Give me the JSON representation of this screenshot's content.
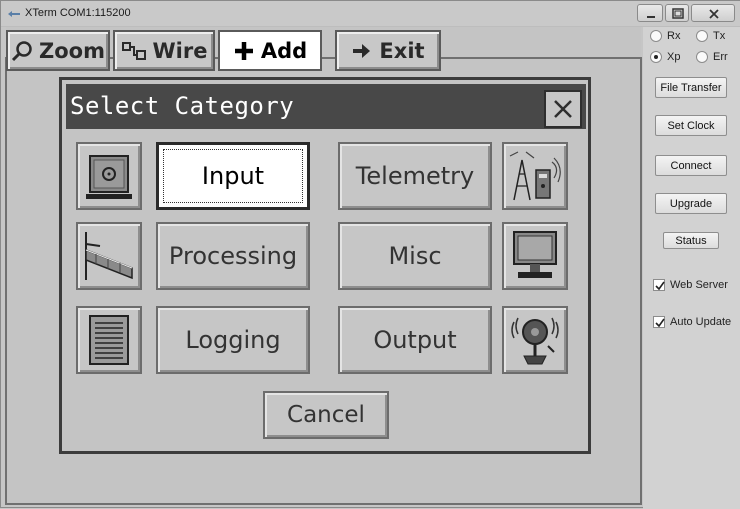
{
  "window": {
    "title": "XTerm COM1:115200"
  },
  "toolbar": {
    "zoom": "Zoom",
    "wire": "Wire",
    "add": "Add",
    "exit": "Exit"
  },
  "dialog": {
    "title": "Select Category",
    "categories": {
      "input": "Input",
      "telemetry": "Telemetry",
      "processing": "Processing",
      "misc": "Misc",
      "logging": "Logging",
      "output": "Output"
    },
    "cancel": "Cancel"
  },
  "side": {
    "radios": {
      "rx": "Rx",
      "tx": "Tx",
      "xp": "Xp",
      "err": "Err",
      "selected": "Xp"
    },
    "buttons": {
      "file_transfer": "File Transfer",
      "set_clock": "Set Clock",
      "connect": "Connect",
      "upgrade": "Upgrade",
      "status": "Status"
    },
    "checks": {
      "web_server": "Web Server",
      "auto_update": "Auto Update",
      "web_server_checked": true,
      "auto_update_checked": true
    }
  },
  "colors": {
    "dialog_title_bg": "#484848",
    "lcd_bg": "#c4c4c4",
    "focused_bg": "#ffffff"
  }
}
